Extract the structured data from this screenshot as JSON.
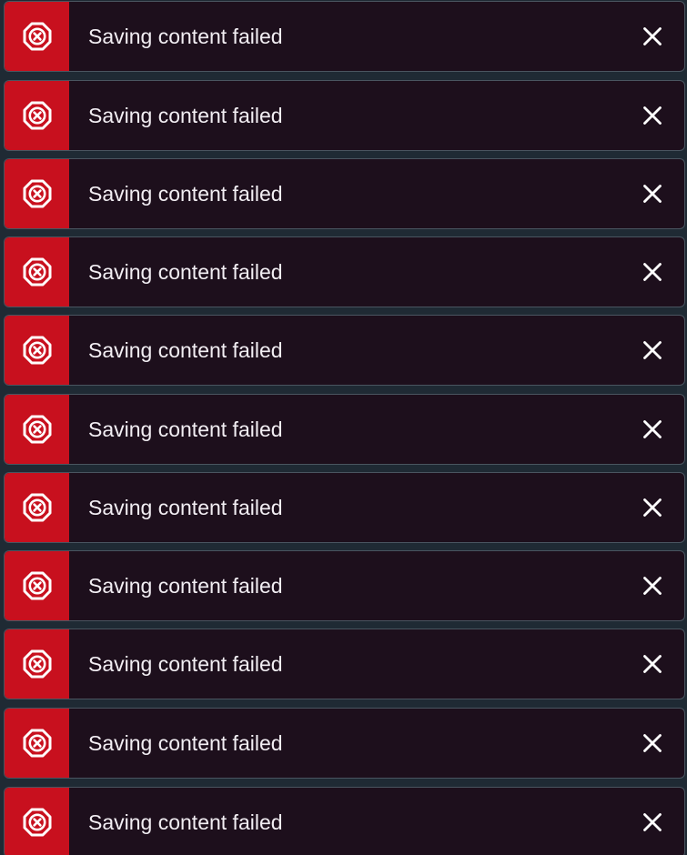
{
  "notifications": {
    "items": [
      {
        "message": "Saving content failed",
        "status_icon": "error-octagon-x-icon",
        "close_icon": "close-x-icon"
      },
      {
        "message": "Saving content failed",
        "status_icon": "error-octagon-x-icon",
        "close_icon": "close-x-icon"
      },
      {
        "message": "Saving content failed",
        "status_icon": "error-octagon-x-icon",
        "close_icon": "close-x-icon"
      },
      {
        "message": "Saving content failed",
        "status_icon": "error-octagon-x-icon",
        "close_icon": "close-x-icon"
      },
      {
        "message": "Saving content failed",
        "status_icon": "error-octagon-x-icon",
        "close_icon": "close-x-icon"
      },
      {
        "message": "Saving content failed",
        "status_icon": "error-octagon-x-icon",
        "close_icon": "close-x-icon"
      },
      {
        "message": "Saving content failed",
        "status_icon": "error-octagon-x-icon",
        "close_icon": "close-x-icon"
      },
      {
        "message": "Saving content failed",
        "status_icon": "error-octagon-x-icon",
        "close_icon": "close-x-icon"
      },
      {
        "message": "Saving content failed",
        "status_icon": "error-octagon-x-icon",
        "close_icon": "close-x-icon"
      },
      {
        "message": "Saving content failed",
        "status_icon": "error-octagon-x-icon",
        "close_icon": "close-x-icon"
      },
      {
        "message": "Saving content failed",
        "status_icon": "error-octagon-x-icon",
        "close_icon": "close-x-icon"
      }
    ]
  },
  "colors": {
    "error_accent": "#c8101e",
    "toast_background": "#1d0f1c",
    "toast_text": "#f2eef3",
    "toast_border": "#4a5560"
  }
}
